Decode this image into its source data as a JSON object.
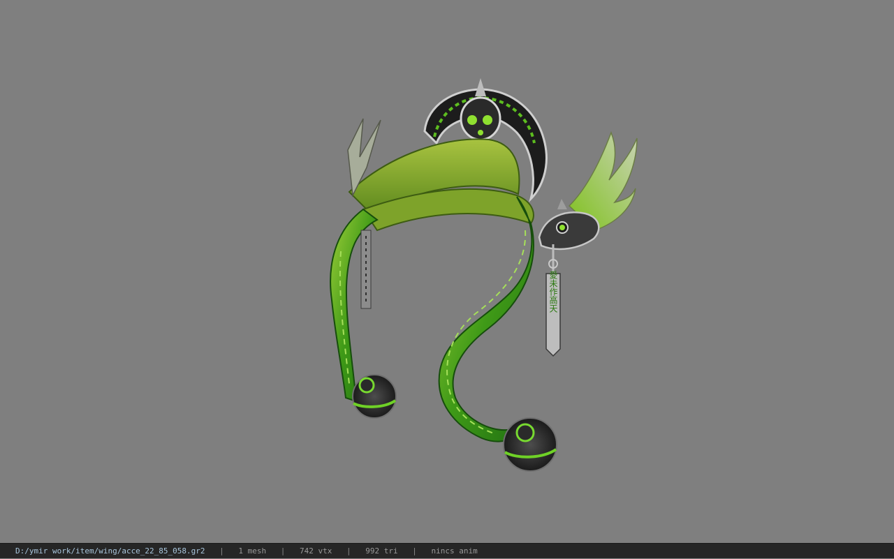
{
  "viewport": {
    "model": "accessory-headpiece-icon",
    "background_color": "#7f7f7f",
    "accent_color": "#55c01e"
  },
  "status_bar": {
    "file_path": "D:/ymir work/item/wing/acce_22_85_058.gr2",
    "separator": "|",
    "mesh_count": "1 mesh",
    "vertex_count": "742 vtx",
    "triangle_count": "992 tri",
    "animation": "nincs anim"
  },
  "pendant_text": "愛未作高天"
}
